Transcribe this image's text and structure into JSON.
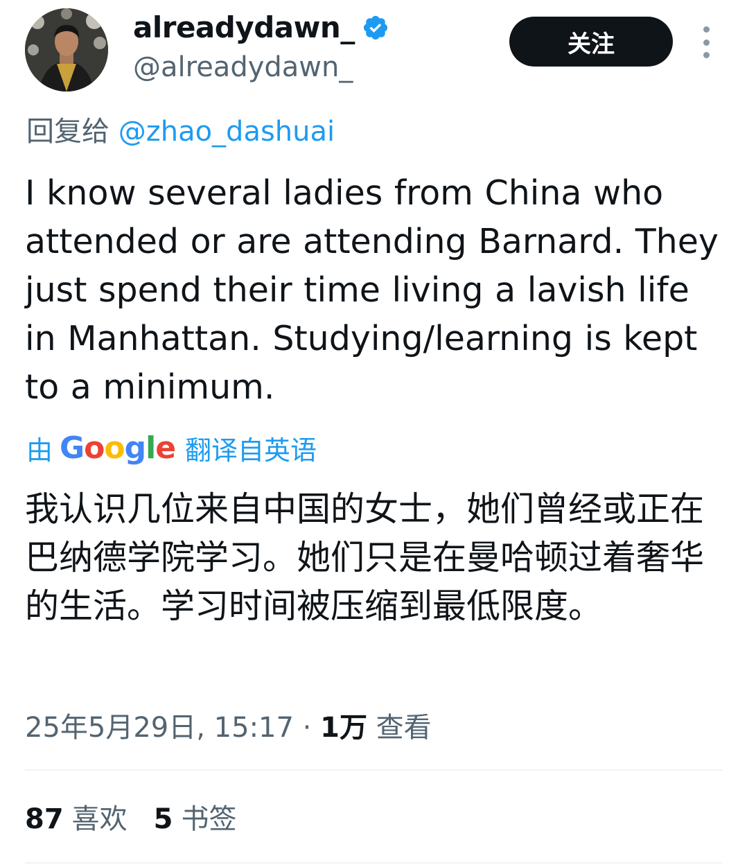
{
  "author": {
    "display_name": "alreadydawn_",
    "handle": "@alreadydawn_",
    "verified": true,
    "avatar_icon": "profile-photo"
  },
  "header": {
    "follow_label": "关注",
    "more_icon": "ellipsis-vertical-icon"
  },
  "reply": {
    "prefix": "回复给",
    "mention": "@zhao_dashuai"
  },
  "tweet": {
    "text": "I know several ladies from China who attended or are attending Barnard. They just spend their time living a lavish life in Manhattan. Studying/learning is kept to a minimum."
  },
  "translation": {
    "prefix": "由",
    "provider": "Google",
    "suffix": "翻译自英语",
    "text": "我认识几位来自中国的女士，她们曾经或正在巴纳德学院学习。她们只是在曼哈顿过着奢华的生活。学习时间被压缩到最低限度。"
  },
  "meta": {
    "timestamp": "25年5月29日, 15:17",
    "separator": "·",
    "views_count": "1万",
    "views_label": "查看"
  },
  "stats": {
    "likes_count": "87",
    "likes_label": "喜欢",
    "bookmarks_count": "5",
    "bookmarks_label": "书签"
  },
  "colors": {
    "text": "#0f1419",
    "secondary": "#536471",
    "link": "#1d9bf0",
    "follow_bg": "#0f1419"
  }
}
